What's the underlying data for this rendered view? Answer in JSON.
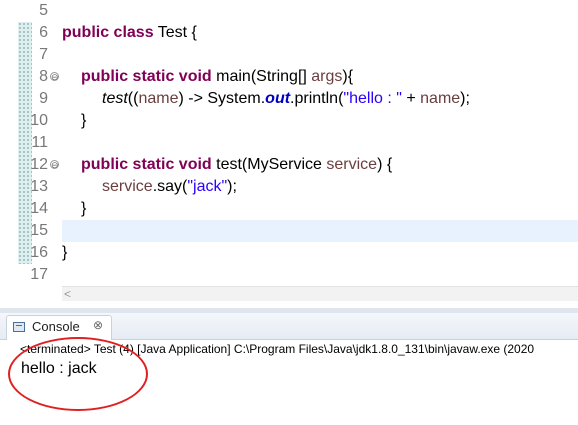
{
  "editor": {
    "lines": [
      {
        "num": "5"
      },
      {
        "num": "6"
      },
      {
        "num": "7"
      },
      {
        "num": "8"
      },
      {
        "num": "9"
      },
      {
        "num": "10"
      },
      {
        "num": "11"
      },
      {
        "num": "12"
      },
      {
        "num": "13"
      },
      {
        "num": "14"
      },
      {
        "num": "15"
      },
      {
        "num": "16"
      },
      {
        "num": "17"
      }
    ],
    "line6": {
      "kw": "public class",
      "name": " Test {"
    },
    "line8": {
      "kw": "public static void",
      "rest": " main(String[] ",
      "param": "args",
      "end": "){"
    },
    "line9": {
      "method": "test",
      "p1": "((",
      "var": "name",
      "p2": ") -> System.",
      "field": "out",
      "p3": ".println(",
      "str": "\"hello : \"",
      "p4": " + ",
      "var2": "name",
      "p5": ");"
    },
    "line10": {
      "text": "}"
    },
    "line12": {
      "kw": "public static void",
      "rest": " test(MyService ",
      "param": "service",
      "end": ") {"
    },
    "line13": {
      "var": "service",
      "rest": ".say(",
      "str": "\"jack\"",
      "end": ");"
    },
    "line14": {
      "text": "}"
    },
    "line16": {
      "text": "}"
    },
    "fold_glyph": "⊖"
  },
  "scrollbar": {
    "left_arrow": "<"
  },
  "console": {
    "tab_label": "Console",
    "close_glyph": "⊗",
    "status": "<terminated> Test (4) [Java Application] C:\\Program Files\\Java\\jdk1.8.0_131\\bin\\javaw.exe (2020",
    "output": "hello : jack"
  },
  "colors": {
    "keyword": "#7f0055",
    "string": "#2a00ff",
    "variable": "#6a3e3e",
    "field": "#0000c0",
    "annotation": "#e02020"
  }
}
